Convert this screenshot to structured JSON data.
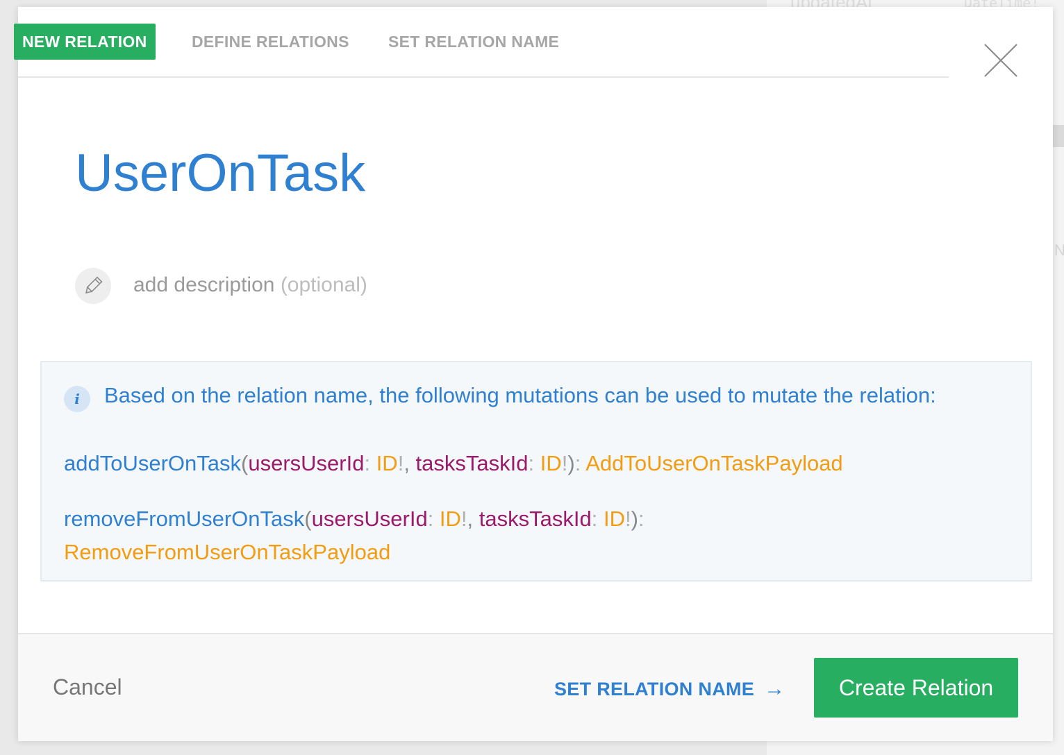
{
  "background": {
    "field_name": "updatedAt",
    "field_type": "DateTime!",
    "hint_letter": "N"
  },
  "tabs": [
    {
      "label": "NEW RELATION",
      "active": true
    },
    {
      "label": "DEFINE RELATIONS",
      "active": false
    },
    {
      "label": "SET RELATION NAME",
      "active": false
    }
  ],
  "modal": {
    "title": "UserOnTask",
    "description": {
      "placeholder": "add description",
      "optional_label": "(optional)"
    },
    "info": {
      "icon": "info-icon",
      "text": "Based on the relation name, the following mutations can be used to mutate the relation:",
      "mutations": [
        {
          "name": "addToUserOnTask",
          "arg1_name": "usersUserId",
          "arg1_type": "ID",
          "arg2_name": "tasksTaskId",
          "arg2_type": "ID",
          "return_type": "AddToUserOnTaskPayload"
        },
        {
          "name": "removeFromUserOnTask",
          "arg1_name": "usersUserId",
          "arg1_type": "ID",
          "arg2_name": "tasksTaskId",
          "arg2_type": "ID",
          "return_type": "RemoveFromUserOnTaskPayload"
        }
      ]
    }
  },
  "footer": {
    "cancel_label": "Cancel",
    "next_label": "SET RELATION NAME",
    "next_arrow": "→",
    "create_label": "Create Relation"
  },
  "colors": {
    "accent_green": "#27ae60",
    "accent_blue": "#2f80d1",
    "arg_purple": "#9c1a6b",
    "type_orange": "#f39c12"
  }
}
